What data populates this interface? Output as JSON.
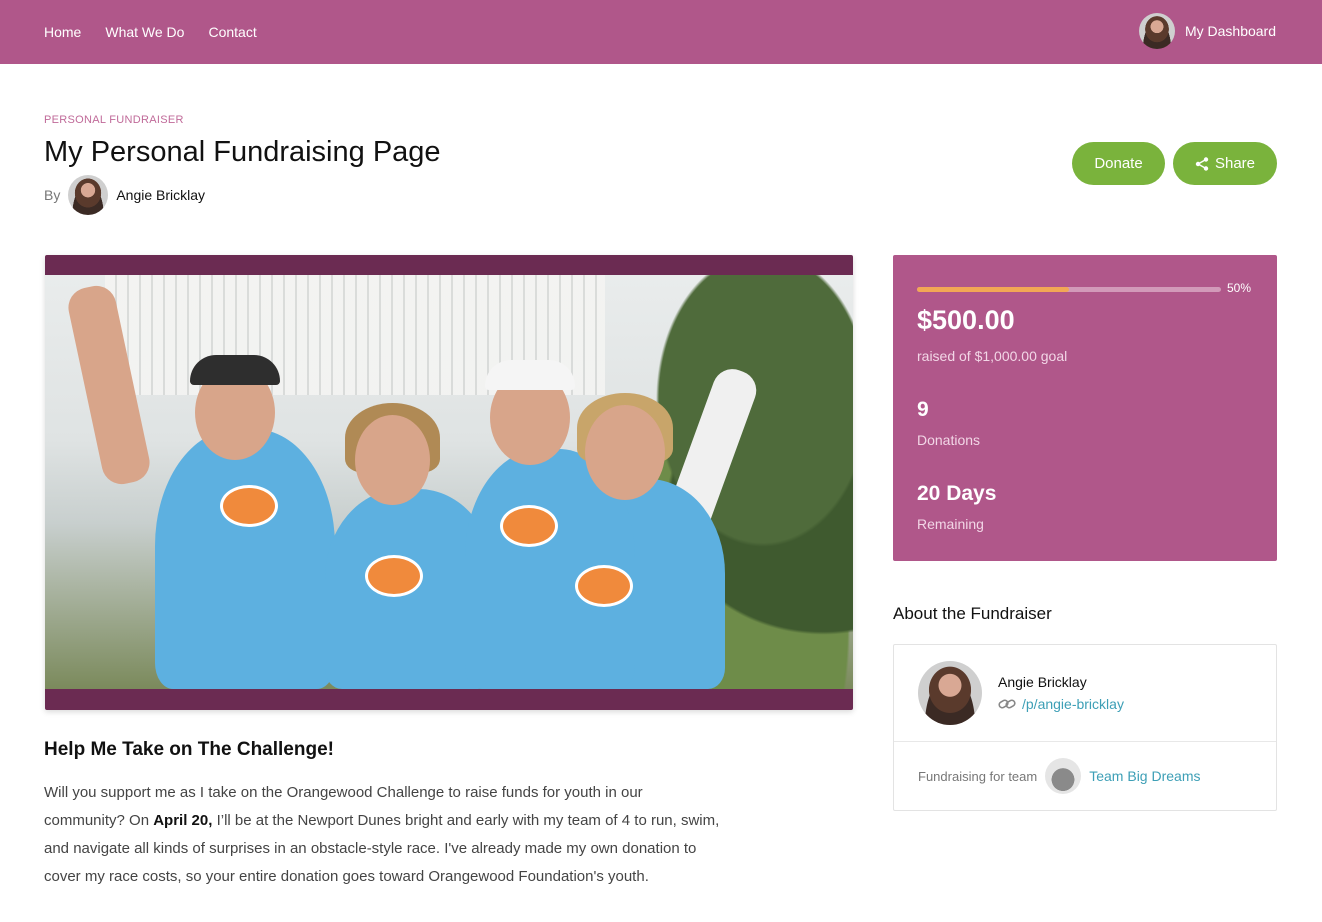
{
  "nav": {
    "items": [
      "Home",
      "What We Do",
      "Contact"
    ],
    "dashboard_label": "My Dashboard"
  },
  "header": {
    "eyebrow": "PERSONAL FUNDRAISER",
    "title": "My Personal Fundraising Page",
    "by_label": "By",
    "author": "Angie Bricklay"
  },
  "actions": {
    "donate_label": "Donate",
    "share_label": "Share"
  },
  "stats": {
    "progress_percent": 50,
    "progress_label": "50%",
    "raised": "$500.00",
    "raised_sub": "raised of $1,000.00 goal",
    "donations_count": "9",
    "donations_label": "Donations",
    "days": "20 Days",
    "days_label": "Remaining"
  },
  "about": {
    "heading": "About the Fundraiser",
    "name": "Angie Bricklay",
    "link": "/p/angie-bricklay",
    "team_label": "Fundraising for team",
    "team_name": "Team Big Dreams"
  },
  "story": {
    "title": "Help Me Take on The Challenge!",
    "p_start": "Will you support me as I take on the Orangewood Challenge to raise funds for youth in our community? On ",
    "p_bold": "April 20,",
    "p_end": " I’ll be at the Newport Dunes bright and early with my team of 4 to run, swim, and navigate all kinds of surprises in an obstacle-style race.  I've already made my own donation to cover my race costs, so your entire donation goes toward Orangewood Foundation's youth."
  },
  "colors": {
    "brand": "#b0578a",
    "accent_green": "#7ab33c",
    "progress": "#f2a755",
    "link": "#3d9fb6"
  },
  "icons": {
    "share": "share-icon",
    "link": "link-icon"
  }
}
